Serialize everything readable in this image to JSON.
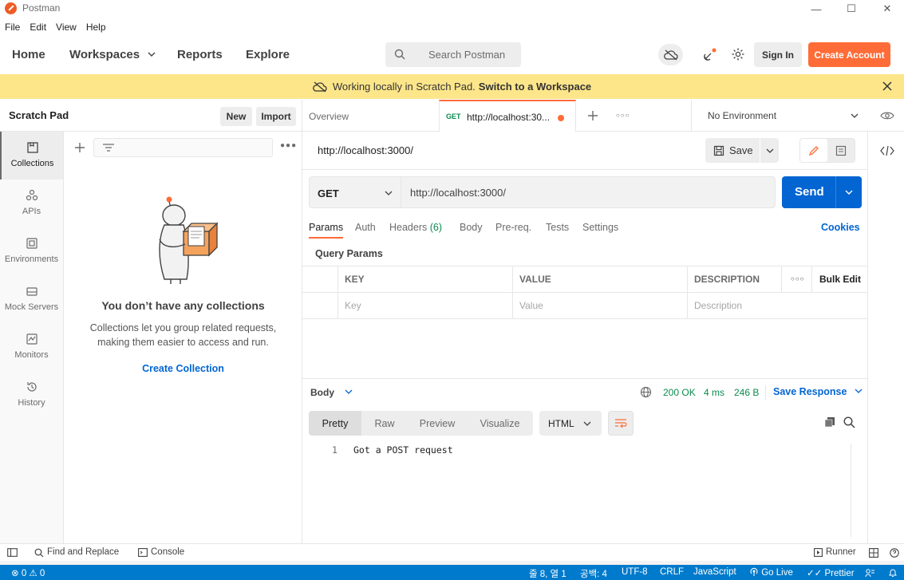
{
  "window": {
    "title": "Postman",
    "minimize": "—",
    "maximize": "☐",
    "close": "✕"
  },
  "menu": [
    "File",
    "Edit",
    "View",
    "Help"
  ],
  "nav": {
    "home": "Home",
    "workspaces": "Workspaces",
    "reports": "Reports",
    "explore": "Explore",
    "search_placeholder": "Search Postman",
    "sign_in": "Sign In",
    "create_account": "Create Account"
  },
  "banner": {
    "text": "Working locally in Scratch Pad.",
    "link": "Switch to a Workspace"
  },
  "sidebar": {
    "title": "Scratch Pad",
    "new_label": "New",
    "import_label": "Import",
    "rail": [
      {
        "label": "Collections",
        "icon": "collections-icon"
      },
      {
        "label": "APIs",
        "icon": "apis-icon"
      },
      {
        "label": "Environments",
        "icon": "environments-icon"
      },
      {
        "label": "Mock Servers",
        "icon": "mock-servers-icon"
      },
      {
        "label": "Monitors",
        "icon": "monitors-icon"
      },
      {
        "label": "History",
        "icon": "history-icon"
      }
    ],
    "empty": {
      "title": "You don’t have any collections",
      "desc": "Collections let you group related requests, making them easier to access and run.",
      "cta": "Create Collection"
    }
  },
  "tabs": {
    "overview": "Overview",
    "active_method": "GET",
    "active_url": "http://localhost:30...",
    "environment": "No Environment"
  },
  "request": {
    "title": "http://localhost:3000/",
    "save": "Save",
    "method": "GET",
    "url": "http://localhost:3000/",
    "send": "Send",
    "tabs": [
      {
        "label": "Params"
      },
      {
        "label": "Auth"
      },
      {
        "label": "Headers",
        "count": "(6)"
      },
      {
        "label": "Body"
      },
      {
        "label": "Pre-req."
      },
      {
        "label": "Tests"
      },
      {
        "label": "Settings"
      }
    ],
    "cookies": "Cookies",
    "query_params_title": "Query Params",
    "table": {
      "headers": [
        "KEY",
        "VALUE",
        "DESCRIPTION"
      ],
      "bulk_edit": "Bulk Edit",
      "placeholders": [
        "Key",
        "Value",
        "Description"
      ]
    }
  },
  "response": {
    "body_label": "Body",
    "status": "200 OK",
    "time": "4 ms",
    "size": "246 B",
    "save_response": "Save Response",
    "view_tabs": [
      "Pretty",
      "Raw",
      "Preview",
      "Visualize"
    ],
    "format": "HTML",
    "lines": [
      {
        "n": "1",
        "text": "Got a POST request"
      }
    ]
  },
  "statusbar": {
    "find_replace": "Find and Replace",
    "console": "Console",
    "runner": "Runner"
  },
  "vscode": {
    "problems": "⊗ 0 ⚠ 0",
    "position": "줄 8, 열 1",
    "spaces": "공백: 4",
    "encoding": "UTF-8",
    "eol": "CRLF",
    "language": "JavaScript",
    "golive": "Go Live",
    "prettier": "Prettier"
  },
  "colors": {
    "accent": "#ff6c37",
    "primary": "#0265d2",
    "success": "#0b8a4f",
    "banner": "#fde68a",
    "vscode": "#007acc"
  }
}
